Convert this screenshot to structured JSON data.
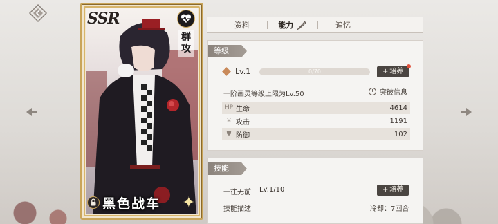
{
  "card": {
    "rarity": "SSR",
    "attack_type": "群攻",
    "character_name": "黑色战车",
    "type_icon": "heartbeat-icon"
  },
  "tabs": [
    {
      "label": "资料",
      "active": false
    },
    {
      "label": "能力",
      "active": true
    },
    {
      "label": "追忆",
      "active": false
    }
  ],
  "level_section": {
    "title": "等级",
    "level": "Lv.1",
    "exp_text": "0/70",
    "exp_fraction": 0,
    "train_label": "培养",
    "cap_text": "一阶画灵等级上限为Lv.50",
    "breakthrough_label": "突破信息",
    "stats": [
      {
        "icon": "HP",
        "name": "生命",
        "value": "4614"
      },
      {
        "icon": "⚔",
        "name": "攻击",
        "value": "1191"
      },
      {
        "icon": "⛊",
        "name": "防御",
        "value": "102"
      }
    ]
  },
  "skill_section": {
    "title": "技能",
    "skill_name": "一往无前",
    "skill_level": "Lv.1/10",
    "train_label": "培养",
    "desc_label": "技能描述",
    "cooldown": "冷却：7回合"
  },
  "colors": {
    "accent_gold": "#c9a55a",
    "button_dark": "#4a4541",
    "notification_red": "#e0503b"
  }
}
